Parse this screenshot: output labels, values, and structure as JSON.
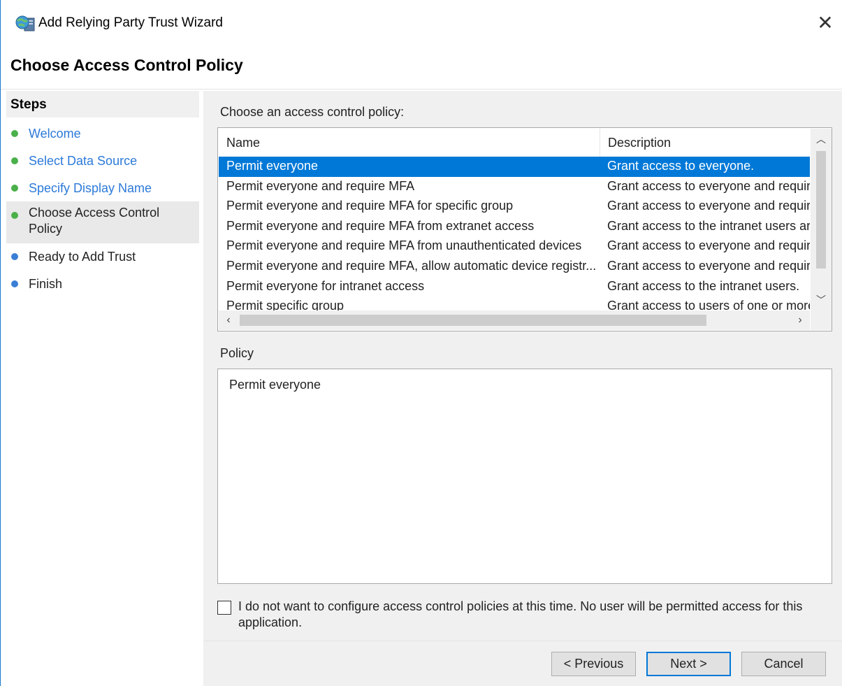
{
  "window": {
    "title": "Add Relying Party Trust Wizard"
  },
  "page": {
    "title": "Choose Access Control Policy"
  },
  "steps": {
    "header": "Steps",
    "items": [
      {
        "label": "Welcome",
        "state": "done"
      },
      {
        "label": "Select Data Source",
        "state": "done"
      },
      {
        "label": "Specify Display Name",
        "state": "done"
      },
      {
        "label_line1": "Choose Access Control",
        "label_line2": "Policy",
        "state": "current"
      },
      {
        "label": "Ready to Add Trust",
        "state": "todo"
      },
      {
        "label": "Finish",
        "state": "todo"
      }
    ]
  },
  "content": {
    "choose_label": "Choose an access control policy:",
    "columns": {
      "name": "Name",
      "description": "Description"
    },
    "rows": [
      {
        "name": "Permit everyone",
        "description": "Grant access to everyone."
      },
      {
        "name": "Permit everyone and require MFA",
        "description": "Grant access to everyone and requir"
      },
      {
        "name": "Permit everyone and require MFA for specific group",
        "description": "Grant access to everyone and requir"
      },
      {
        "name": "Permit everyone and require MFA from extranet access",
        "description": "Grant access to the intranet users ar"
      },
      {
        "name": "Permit everyone and require MFA from unauthenticated devices",
        "description": "Grant access to everyone and requir"
      },
      {
        "name": "Permit everyone and require MFA, allow automatic device registr...",
        "description": "Grant access to everyone and requir"
      },
      {
        "name": "Permit everyone for intranet access",
        "description": "Grant access to the intranet users."
      },
      {
        "name": "Permit specific group",
        "description": "Grant access to users of one or more"
      }
    ],
    "selected_row": "Permit everyone",
    "policy_label": "Policy",
    "policy_text": "Permit everyone",
    "checkbox_label": "I do not want to configure access control policies at this time. No user will be permitted access for this application.",
    "checkbox_checked": false
  },
  "buttons": {
    "previous": "< Previous",
    "next": "Next >",
    "cancel": "Cancel"
  },
  "colors": {
    "selection": "#0078d7",
    "done_dot": "#4ab04a",
    "todo_dot": "#3a7fd6",
    "link_text": "#2c7ad8"
  },
  "icons": {
    "app": "relying-party-globe-icon",
    "close": "close-icon",
    "scroll_up": "chevron-up-icon",
    "scroll_down": "chevron-down-icon",
    "scroll_left": "chevron-left-icon",
    "scroll_right": "chevron-right-icon"
  }
}
